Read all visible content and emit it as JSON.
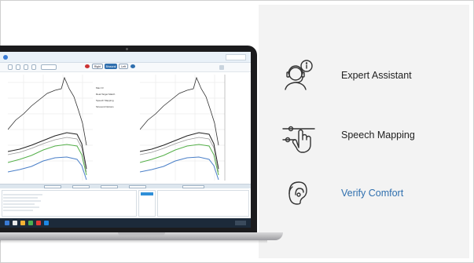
{
  "features": [
    {
      "label": "Expert Assistant",
      "icon": "expert-assistant-icon",
      "active": false
    },
    {
      "label": "Speech Mapping",
      "icon": "speech-mapping-icon",
      "active": false
    },
    {
      "label": "Verify Comfort",
      "icon": "verify-comfort-icon",
      "active": true
    }
  ],
  "colors": {
    "accent": "#2f6fae",
    "panel_bg": "#f3f3f3",
    "curve_black": "#333333",
    "curve_green": "#55b04a",
    "curve_blue": "#4a7fc8",
    "curve_grey": "#9a9a9a"
  },
  "app": {
    "ear_buttons": [
      "Right",
      "Binaural",
      "Left"
    ],
    "legend": [
      "Max O/",
      "Real Target Match",
      "Speech Mapping",
      "Sinusoid Options"
    ]
  }
}
